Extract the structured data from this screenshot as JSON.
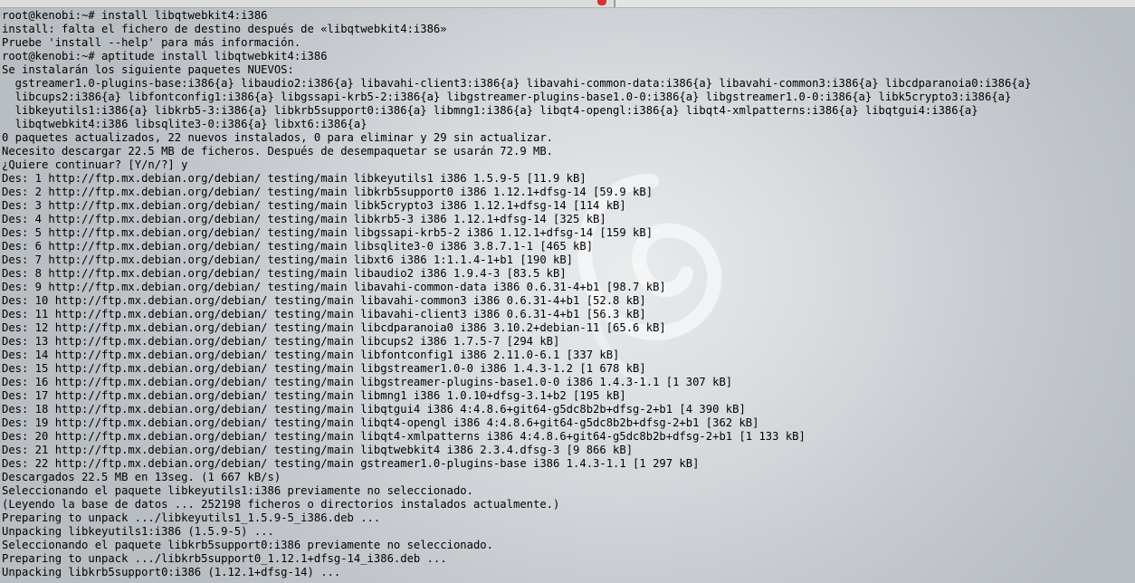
{
  "terminal": {
    "lines": [
      "root@kenobi:~# install libqtwebkit4:i386",
      "install: falta el fichero de destino después de «libqtwebkit4:i386»",
      "Pruebe 'install --help' para más información.",
      "root@kenobi:~# aptitude install libqtwebkit4:i386",
      "Se instalarán los siguiente paquetes NUEVOS:",
      "  gstreamer1.0-plugins-base:i386{a} libaudio2:i386{a} libavahi-client3:i386{a} libavahi-common-data:i386{a} libavahi-common3:i386{a} libcdparanoia0:i386{a}",
      "  libcups2:i386{a} libfontconfig1:i386{a} libgssapi-krb5-2:i386{a} libgstreamer-plugins-base1.0-0:i386{a} libgstreamer1.0-0:i386{a} libk5crypto3:i386{a}",
      "  libkeyutils1:i386{a} libkrb5-3:i386{a} libkrb5support0:i386{a} libmng1:i386{a} libqt4-opengl:i386{a} libqt4-xmlpatterns:i386{a} libqtgui4:i386{a}",
      "  libqtwebkit4:i386 libsqlite3-0:i386{a} libxt6:i386{a}",
      "0 paquetes actualizados, 22 nuevos instalados, 0 para eliminar y 29 sin actualizar.",
      "Necesito descargar 22.5 MB de ficheros. Después de desempaquetar se usarán 72.9 MB.",
      "¿Quiere continuar? [Y/n/?] y",
      "Des: 1 http://ftp.mx.debian.org/debian/ testing/main libkeyutils1 i386 1.5.9-5 [11.9 kB]",
      "Des: 2 http://ftp.mx.debian.org/debian/ testing/main libkrb5support0 i386 1.12.1+dfsg-14 [59.9 kB]",
      "Des: 3 http://ftp.mx.debian.org/debian/ testing/main libk5crypto3 i386 1.12.1+dfsg-14 [114 kB]",
      "Des: 4 http://ftp.mx.debian.org/debian/ testing/main libkrb5-3 i386 1.12.1+dfsg-14 [325 kB]",
      "Des: 5 http://ftp.mx.debian.org/debian/ testing/main libgssapi-krb5-2 i386 1.12.1+dfsg-14 [159 kB]",
      "Des: 6 http://ftp.mx.debian.org/debian/ testing/main libsqlite3-0 i386 3.8.7.1-1 [465 kB]",
      "Des: 7 http://ftp.mx.debian.org/debian/ testing/main libxt6 i386 1:1.1.4-1+b1 [190 kB]",
      "Des: 8 http://ftp.mx.debian.org/debian/ testing/main libaudio2 i386 1.9.4-3 [83.5 kB]",
      "Des: 9 http://ftp.mx.debian.org/debian/ testing/main libavahi-common-data i386 0.6.31-4+b1 [98.7 kB]",
      "Des: 10 http://ftp.mx.debian.org/debian/ testing/main libavahi-common3 i386 0.6.31-4+b1 [52.8 kB]",
      "Des: 11 http://ftp.mx.debian.org/debian/ testing/main libavahi-client3 i386 0.6.31-4+b1 [56.3 kB]",
      "Des: 12 http://ftp.mx.debian.org/debian/ testing/main libcdparanoia0 i386 3.10.2+debian-11 [65.6 kB]",
      "Des: 13 http://ftp.mx.debian.org/debian/ testing/main libcups2 i386 1.7.5-7 [294 kB]",
      "Des: 14 http://ftp.mx.debian.org/debian/ testing/main libfontconfig1 i386 2.11.0-6.1 [337 kB]",
      "Des: 15 http://ftp.mx.debian.org/debian/ testing/main libgstreamer1.0-0 i386 1.4.3-1.2 [1 678 kB]",
      "Des: 16 http://ftp.mx.debian.org/debian/ testing/main libgstreamer-plugins-base1.0-0 i386 1.4.3-1.1 [1 307 kB]",
      "Des: 17 http://ftp.mx.debian.org/debian/ testing/main libmng1 i386 1.0.10+dfsg-3.1+b2 [195 kB]",
      "Des: 18 http://ftp.mx.debian.org/debian/ testing/main libqtgui4 i386 4:4.8.6+git64-g5dc8b2b+dfsg-2+b1 [4 390 kB]",
      "Des: 19 http://ftp.mx.debian.org/debian/ testing/main libqt4-opengl i386 4:4.8.6+git64-g5dc8b2b+dfsg-2+b1 [362 kB]",
      "Des: 20 http://ftp.mx.debian.org/debian/ testing/main libqt4-xmlpatterns i386 4:4.8.6+git64-g5dc8b2b+dfsg-2+b1 [1 133 kB]",
      "Des: 21 http://ftp.mx.debian.org/debian/ testing/main libqtwebkit4 i386 2.3.4.dfsg-3 [9 866 kB]",
      "Des: 22 http://ftp.mx.debian.org/debian/ testing/main gstreamer1.0-plugins-base i386 1.4.3-1.1 [1 297 kB]",
      "Descargados 22.5 MB en 13seg. (1 667 kB/s)",
      "Seleccionando el paquete libkeyutils1:i386 previamente no seleccionado.",
      "(Leyendo la base de datos ... 252198 ficheros o directorios instalados actualmente.)",
      "Preparing to unpack .../libkeyutils1_1.5.9-5_i386.deb ...",
      "Unpacking libkeyutils1:i386 (1.5.9-5) ...",
      "Seleccionando el paquete libkrb5support0:i386 previamente no seleccionado.",
      "Preparing to unpack .../libkrb5support0_1.12.1+dfsg-14_i386.deb ...",
      "Unpacking libkrb5support0:i386 (1.12.1+dfsg-14) ..."
    ]
  },
  "colors": {
    "text": "#000000",
    "background": "#c3c8cd",
    "close_button": "#d9342b"
  }
}
